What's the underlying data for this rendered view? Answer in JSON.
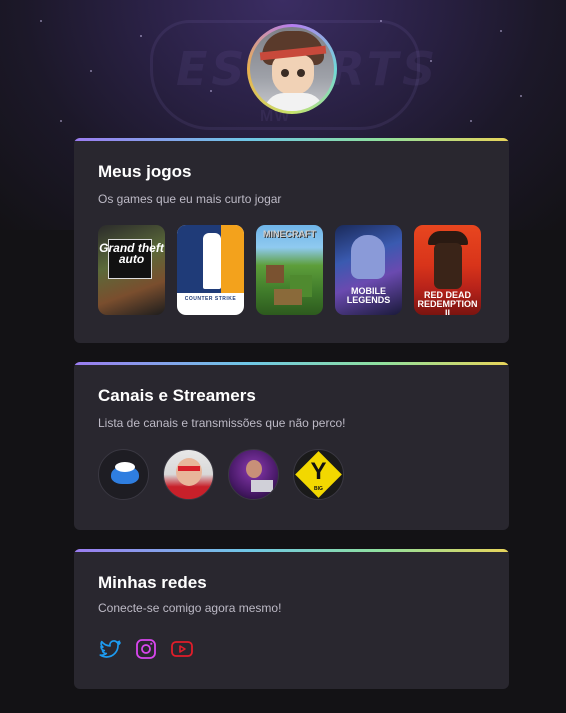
{
  "profile": {
    "avatar_icon": "anime-avatar-portrait"
  },
  "games_card": {
    "title": "Meus jogos",
    "subtitle": "Os games que eu mais curto jogar",
    "games": [
      {
        "name": "Grand Theft Auto V",
        "cover_text": "Grand theft auto",
        "accent": "#5b6a3a"
      },
      {
        "name": "Counter-Strike",
        "cover_text": "COUNTER STRIKE",
        "accent": "#f3a21c"
      },
      {
        "name": "Minecraft",
        "cover_text": "MINECRAFT",
        "accent": "#5d9e3a"
      },
      {
        "name": "Mobile Legends",
        "cover_text": "MOBILE LEGENDS",
        "accent": "#3a5ab0"
      },
      {
        "name": "Red Dead Redemption II",
        "cover_text": "RED DEAD REDEMPTION II",
        "accent": "#d8341a"
      }
    ]
  },
  "streams_card": {
    "title": "Canais e Streamers",
    "subtitle": "Lista de canais e transmissões que não perco!",
    "streamers": [
      {
        "icon": "winged-logo-icon"
      },
      {
        "icon": "streamer-red-glasses"
      },
      {
        "icon": "streamer-dj"
      },
      {
        "icon": "y-diamond-logo-icon",
        "logo_letter": "Y",
        "logo_sub": "BIG"
      }
    ]
  },
  "social_card": {
    "title": "Minhas redes",
    "subtitle": "Conecte-se comigo agora mesmo!",
    "links": [
      {
        "icon": "twitter-icon",
        "color": "#1d9bf0"
      },
      {
        "icon": "instagram-icon",
        "color": "#d946ef"
      },
      {
        "icon": "youtube-icon",
        "color": "#e11d2a"
      }
    ]
  },
  "colors": {
    "background": "#131215",
    "card": "#29272f",
    "accent_gradient": [
      "#9b7cf0",
      "#6fc7e6",
      "#8fe0a0",
      "#e8d45a"
    ]
  }
}
